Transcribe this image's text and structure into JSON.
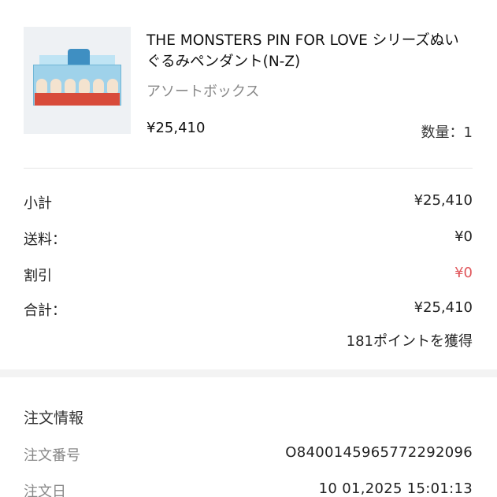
{
  "product": {
    "title": "THE MONSTERS PIN FOR LOVE シリーズぬいぐるみペンダント(N-Z)",
    "variant": "アソートボックス",
    "price": "¥25,410",
    "quantity_label": "数量：1"
  },
  "summary": {
    "subtotal_label": "小計",
    "subtotal_value": "¥25,410",
    "shipping_label": "送料：",
    "shipping_value": "¥0",
    "discount_label": "割引",
    "discount_value": "¥0",
    "total_label": "合計：",
    "total_value": "¥25,410",
    "points_text": "181ポイントを獲得"
  },
  "order_info": {
    "section_title": "注文情報",
    "order_number_label": "注文番号",
    "order_number_value": "O840014596577229​2096",
    "order_date_label": "注文日",
    "order_date_value": "10 01,2025 15:01:13"
  },
  "colors": {
    "discount_red": "#e0565b",
    "muted_gray": "#888888",
    "divider": "#e5e5e5"
  }
}
